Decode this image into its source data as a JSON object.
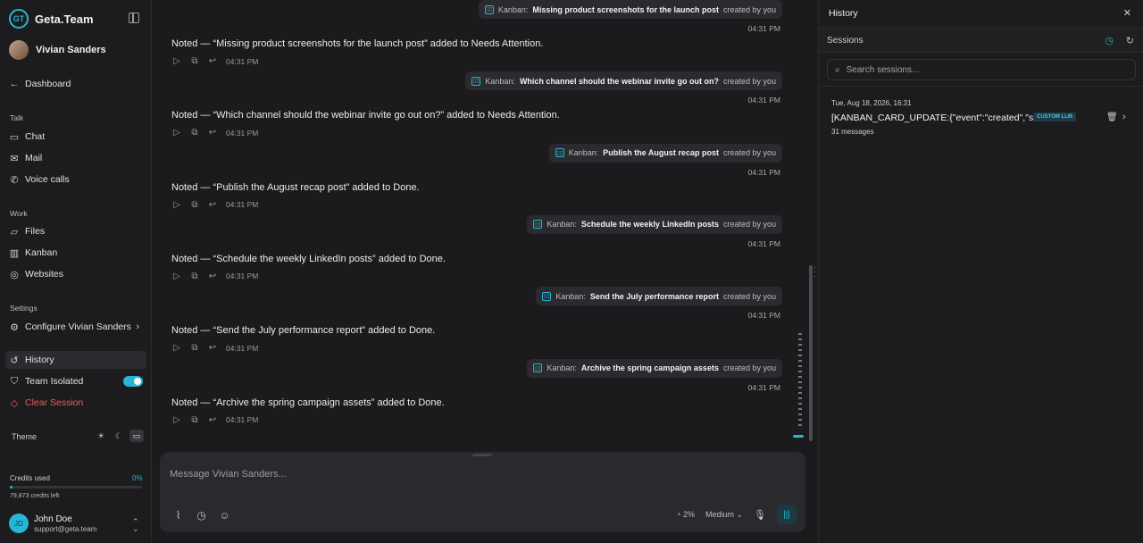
{
  "sidebar": {
    "brand": "Geta.Team",
    "agent_name": "Vivian Sanders",
    "dashboard": "Dashboard",
    "talk_section": "Talk",
    "talk_items": [
      "Chat",
      "Mail",
      "Voice calls"
    ],
    "work_section": "Work",
    "work_items": [
      "Files",
      "Kanban",
      "Websites"
    ],
    "settings_section": "Settings",
    "configure": "Configure Vivian Sanders",
    "history": "History",
    "team_isolated": "Team Isolated",
    "team_isolated_on": true,
    "clear_session": "Clear Session",
    "theme_label": "Theme",
    "theme_selected": "system",
    "credits_label": "Credits used",
    "credits_pct": "0%",
    "credits_used_fraction": 0.02,
    "credits_left": "79,873 credits left",
    "user": {
      "initials": "JD",
      "name": "John Doe",
      "email": "support@geta.team"
    }
  },
  "chat": {
    "messages": [
      {
        "kanban": "Kanban:",
        "title": "Missing product screenshots for the launch post",
        "created_by": "created by you",
        "time": "04:31 PM",
        "reply": "Noted — “Missing product screenshots for the launch post” added to Needs Attention.",
        "reply_time": "04:31 PM"
      },
      {
        "kanban": "Kanban:",
        "title": "Which channel should the webinar invite go out on?",
        "created_by": "created by you",
        "time": "04:31 PM",
        "reply": "Noted — “Which channel should the webinar invite go out on?” added to Needs Attention.",
        "reply_time": "04:31 PM"
      },
      {
        "kanban": "Kanban:",
        "title": "Publish the August recap post",
        "created_by": "created by you",
        "time": "04:31 PM",
        "reply": "Noted — “Publish the August recap post” added to Done.",
        "reply_time": "04:31 PM"
      },
      {
        "kanban": "Kanban:",
        "title": "Schedule the weekly LinkedIn posts",
        "created_by": "created by you",
        "time": "04:31 PM",
        "reply": "Noted — “Schedule the weekly LinkedIn posts” added to Done.",
        "reply_time": "04:31 PM"
      },
      {
        "kanban": "Kanban:",
        "title": "Send the July performance report",
        "created_by": "created by you",
        "time": "04:31 PM",
        "reply": "Noted — “Send the July performance report” added to Done.",
        "reply_time": "04:31 PM"
      },
      {
        "kanban": "Kanban:",
        "title": "Archive the spring campaign assets",
        "created_by": "created by you",
        "time": "04:31 PM",
        "reply": "Noted — “Archive the spring campaign assets” added to Done.",
        "reply_time": "04:31 PM"
      }
    ],
    "composer": {
      "placeholder": "Message Vivian Sanders...",
      "usage": "2%",
      "mode": "Medium"
    }
  },
  "history": {
    "title": "History",
    "sessions_label": "Sessions",
    "search_placeholder": "Search sessions...",
    "session": {
      "date": "Tue, Aug 18, 2026, 16:31",
      "title": "[KANBAN_CARD_UPDATE:{\"event\":\"created\",\"s...",
      "badge": "CUSTOM LLM",
      "count": "31 messages"
    }
  },
  "colors": {
    "accent": "#27b6d6",
    "danger": "#ef5b5b",
    "background": "#1b1b1d"
  }
}
